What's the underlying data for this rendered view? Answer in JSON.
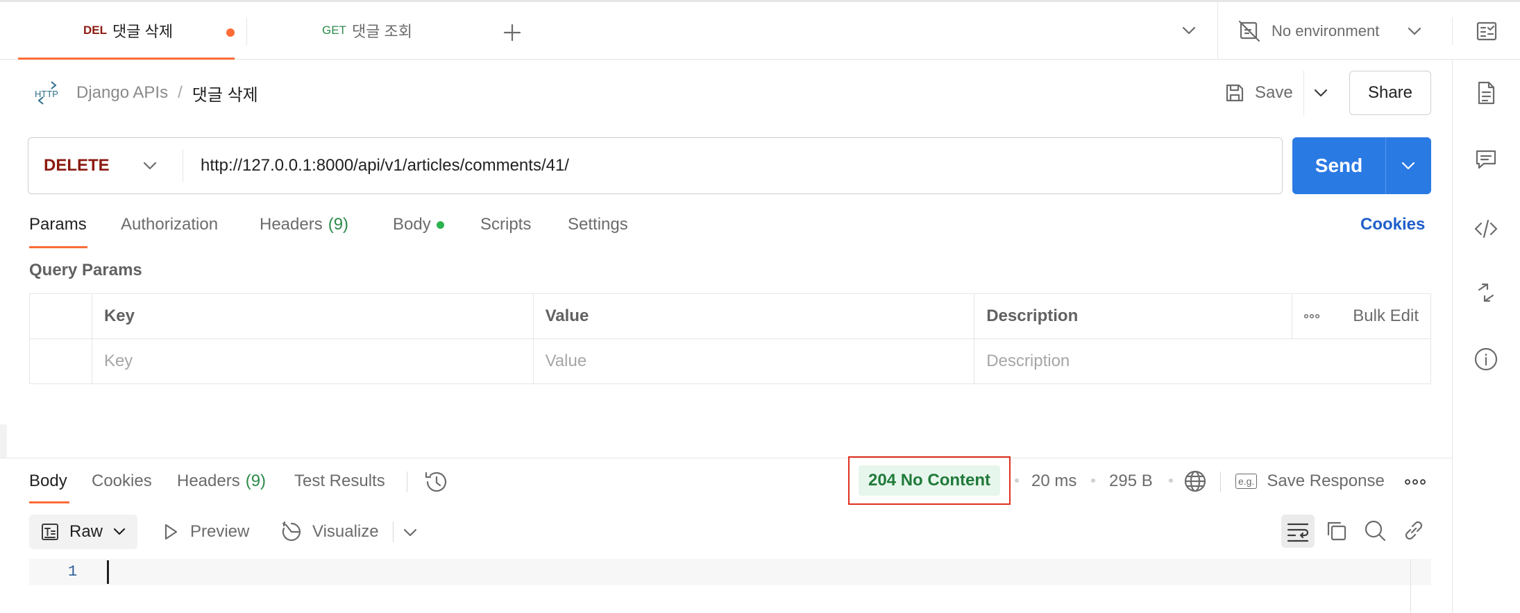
{
  "tabs": [
    {
      "method": "DEL",
      "title": "댓글 삭제",
      "method_color": "#8b1a10",
      "unsaved": true,
      "active": true
    },
    {
      "method": "GET",
      "title": "댓글 조회",
      "method_color": "#2c8a4a",
      "unsaved": false,
      "active": false
    }
  ],
  "environment": {
    "label": "No environment"
  },
  "breadcrumb": {
    "collection": "Django APIs",
    "separator": "/",
    "request": "댓글 삭제",
    "http_icon_text": "HTTP"
  },
  "toolbar": {
    "save_label": "Save",
    "share_label": "Share"
  },
  "request": {
    "method": "DELETE",
    "method_color": "#8b1a10",
    "url": "http://127.0.0.1:8000/api/v1/articles/comments/41/",
    "send_label": "Send"
  },
  "request_tabs": {
    "params": "Params",
    "authorization": "Authorization",
    "headers": "Headers",
    "headers_count": "(9)",
    "body": "Body",
    "scripts": "Scripts",
    "settings": "Settings",
    "cookies": "Cookies"
  },
  "query_params": {
    "title": "Query Params",
    "columns": {
      "key": "Key",
      "value": "Value",
      "description": "Description",
      "bulk_edit": "Bulk Edit"
    },
    "placeholders": {
      "key": "Key",
      "value": "Value",
      "description": "Description"
    }
  },
  "response_tabs": {
    "body": "Body",
    "cookies": "Cookies",
    "headers": "Headers",
    "headers_count": "(9)",
    "test_results": "Test Results"
  },
  "response_meta": {
    "status": "204 No Content",
    "time": "20 ms",
    "size": "295 B",
    "save_response": "Save Response",
    "eg_badge": "e.g."
  },
  "response_view": {
    "format": "Raw",
    "preview": "Preview",
    "visualize": "Visualize"
  },
  "editor": {
    "line_number": "1"
  },
  "colors": {
    "accent": "#ff6c37",
    "send": "#2a7ae4",
    "link": "#1f5fc9",
    "success": "#1f7a3a",
    "highlight": "#e0301e"
  }
}
